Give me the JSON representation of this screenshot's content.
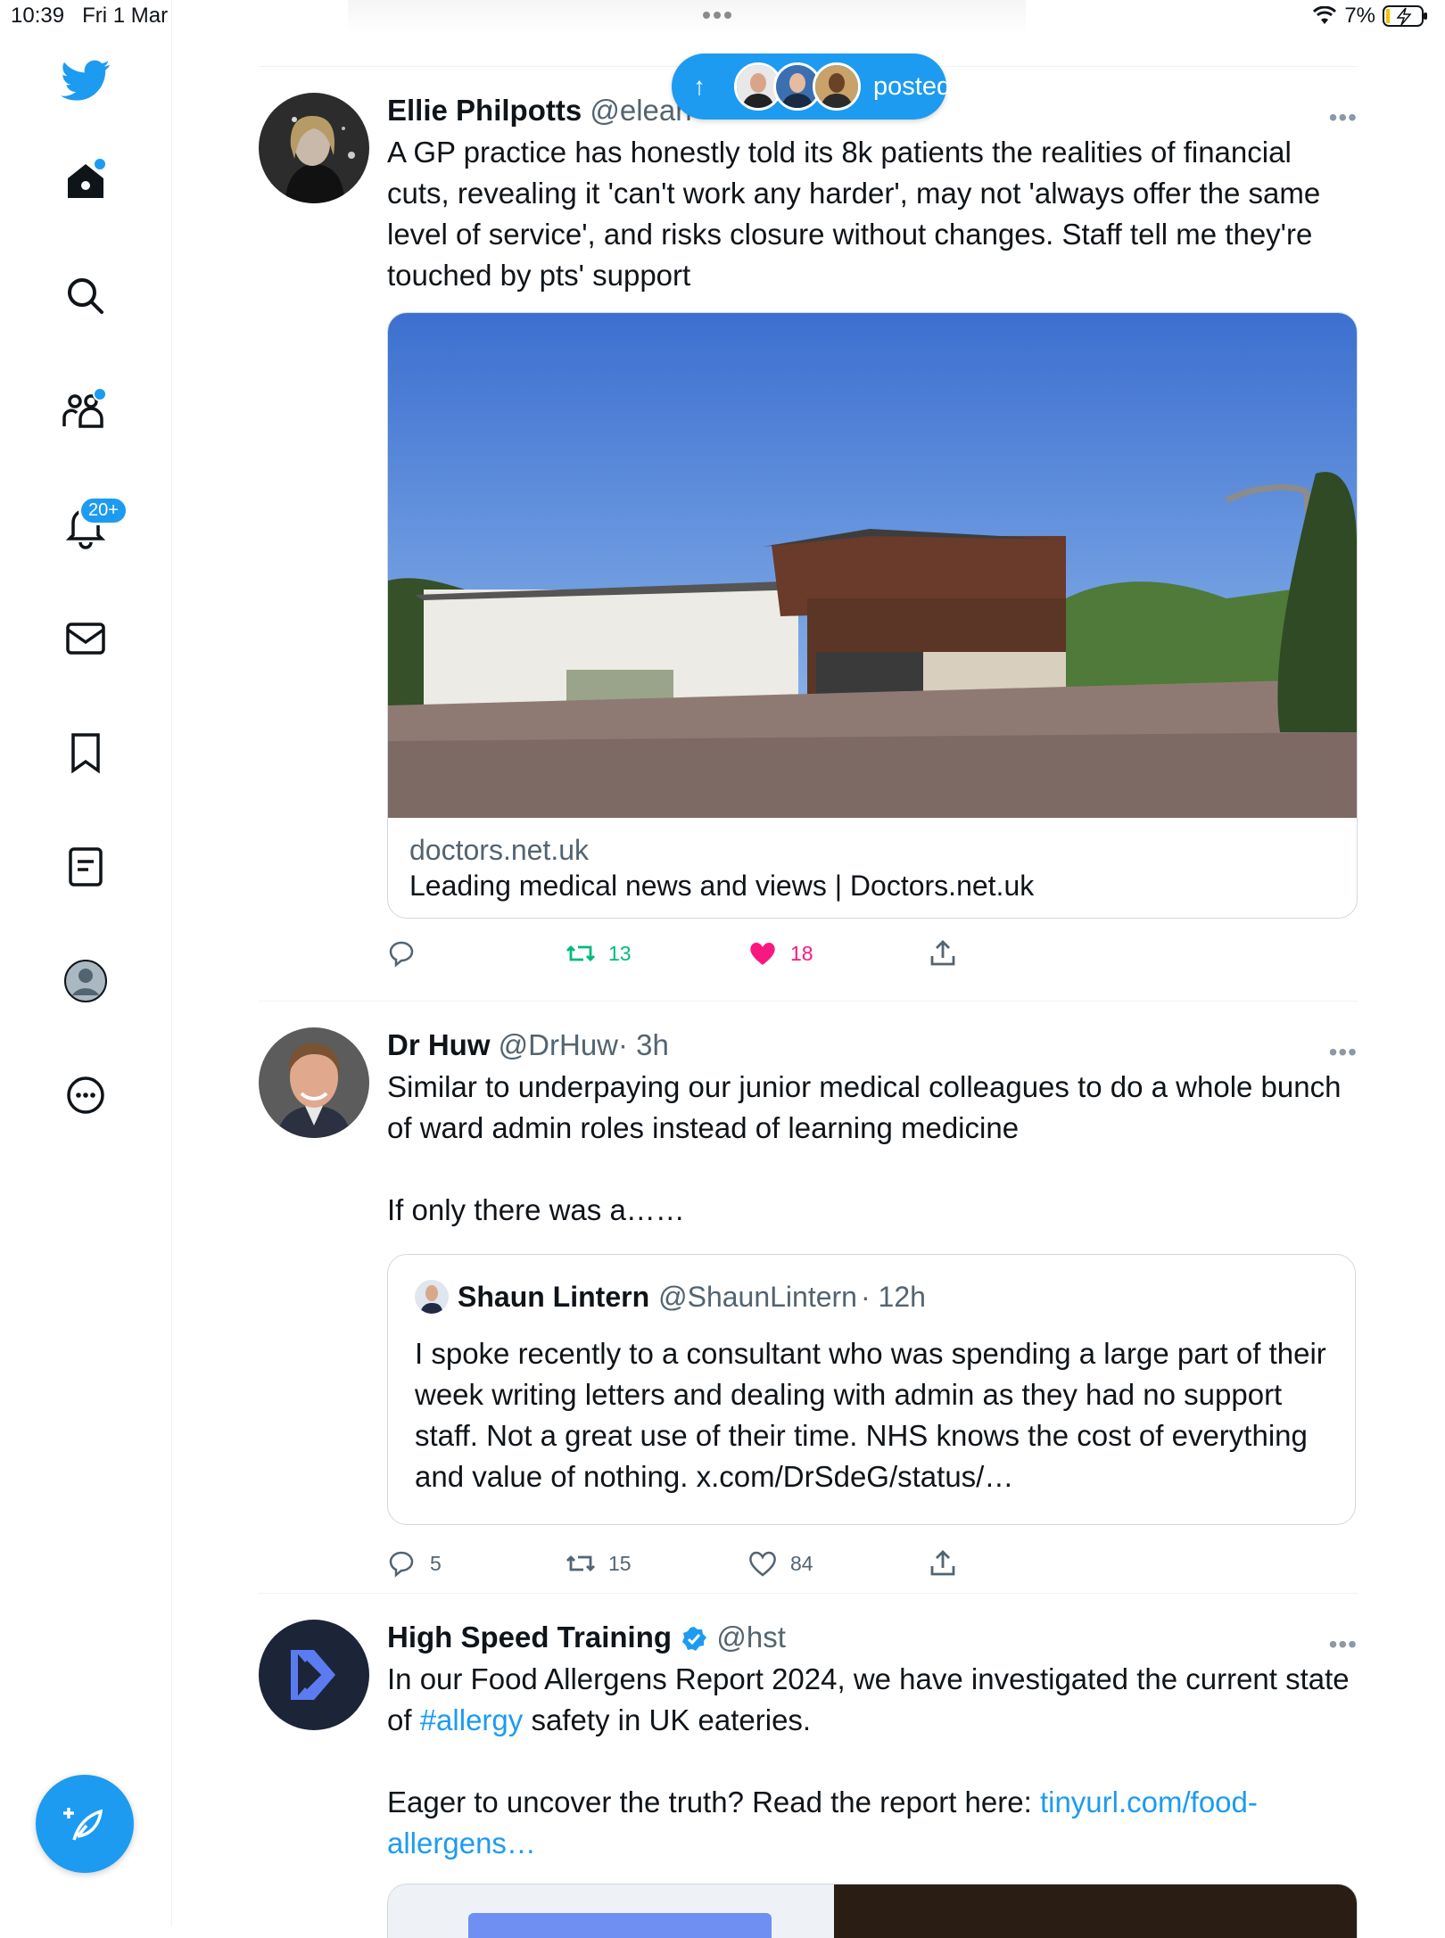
{
  "status_bar": {
    "time": "10:39",
    "date": "Fri 1 Mar",
    "battery": "7%"
  },
  "sidebar": {
    "notifications_badge": "20+",
    "items": [
      "twitter-logo",
      "home",
      "search",
      "communities",
      "notifications",
      "messages",
      "bookmarks",
      "lists",
      "profile",
      "more"
    ]
  },
  "new_posts_pill": {
    "label": "posted"
  },
  "tweets": [
    {
      "name": "Ellie Philpotts",
      "handle": "@elean",
      "text": "A GP practice has honestly told its 8k patients the realities of financial cuts, revealing it 'can't work any harder', may not 'always offer the same level of service', and risks closure without changes. Staff tell me they're touched by pts' support",
      "card": {
        "domain": "doctors.net.uk",
        "title": "Leading medical news and views | Doctors.net.uk"
      },
      "replies": "",
      "retweets": "13",
      "likes": "18",
      "liked": true,
      "retweeted": true
    },
    {
      "name": "Dr Huw",
      "handle": "@DrHuw",
      "time": "· 3h",
      "text_1": "Similar to underpaying our junior medical colleagues to do a whole bunch of ward admin roles instead of learning medicine",
      "text_2": "If only there was a……",
      "quote": {
        "name": "Shaun Lintern",
        "handle": "@ShaunLintern",
        "time": "· 12h",
        "text": "I spoke recently to a consultant who was spending a large part of their week writing letters and dealing with admin as they had no support staff. Not a great use of their time. NHS knows the cost of everything and value of nothing. x.com/DrSdeG/status/…"
      },
      "replies": "5",
      "retweets": "15",
      "likes": "84"
    },
    {
      "name": "High Speed Training",
      "handle": "@hst",
      "verified": true,
      "text_1a": "In our Food Allergens Report 2024, we have investigated the current state of ",
      "hashtag": "#allergy",
      "text_1b": " safety in UK eateries.",
      "text_2a": "Eager to uncover the truth? Read the report here: ",
      "url_1": "tinyurl.com/food-",
      "url_2": "allergens…"
    }
  ],
  "colors": {
    "accent": "#1d9bf0",
    "like": "#f91880",
    "retweet": "#00ba7c",
    "secondary": "#536471"
  }
}
